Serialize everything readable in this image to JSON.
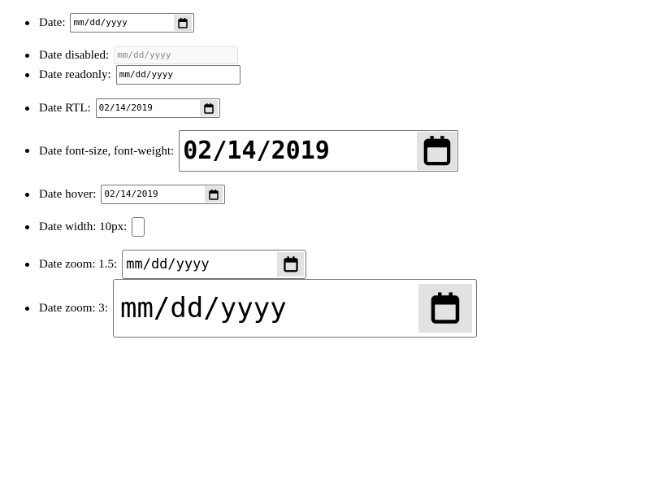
{
  "items": [
    {
      "label": "Date:",
      "value": "mm/dd/yyyy",
      "has_picker": true,
      "state": "normal"
    },
    {
      "label": "Date disabled:",
      "value": "mm/dd/yyyy",
      "has_picker": false,
      "state": "disabled"
    },
    {
      "label": "Date readonly:",
      "value": "mm/dd/yyyy",
      "has_picker": false,
      "state": "readonly"
    },
    {
      "label": "Date RTL:",
      "value": "02/14/2019",
      "has_picker": true,
      "state": "normal"
    },
    {
      "label": "Date font-size, font-weight:",
      "value": "02/14/2019",
      "has_picker": true,
      "state": "normal"
    },
    {
      "label": "Date hover:",
      "value": "02/14/2019",
      "has_picker": true,
      "state": "hover"
    },
    {
      "label": "Date width: 10px:",
      "value": "",
      "has_picker": false,
      "state": "normal"
    },
    {
      "label": "Date zoom: 1.5:",
      "value": "mm/dd/yyyy",
      "has_picker": true,
      "state": "normal"
    },
    {
      "label": "Date zoom: 3:",
      "value": "mm/dd/yyyy",
      "has_picker": true,
      "state": "normal"
    }
  ],
  "icons": {
    "picker": "calendar-icon",
    "bullet": "bullet-dot"
  },
  "colors": {
    "border": "#767676",
    "picker_bg": "#e2e2e2",
    "disabled_text": "#8a8a8a",
    "disabled_border": "#e3e3e3"
  }
}
